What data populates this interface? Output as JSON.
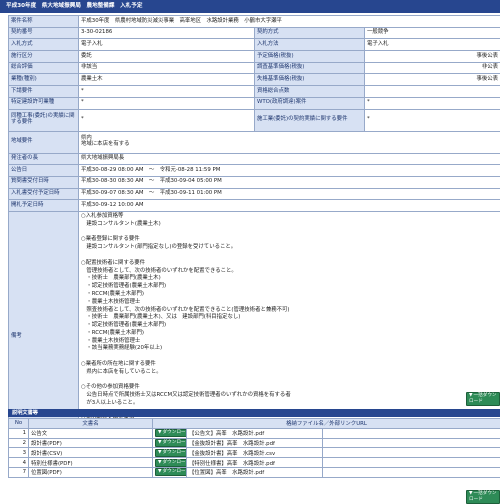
{
  "header": {
    "title": "平成30年度　県大地域振興局　農地整備課　入札予定"
  },
  "info_rows": [
    {
      "label1": "案件名称",
      "value1": "平成30年度　県農村地域防災減災事業　高峯地区　水路設計業務　小鶴市大字瀬平",
      "label2": "",
      "value2": "",
      "span": true
    },
    {
      "label1": "契約番号",
      "value1": "3-30-02186",
      "label2": "契約方式",
      "value2": "一般競争"
    },
    {
      "label1": "入札方式",
      "value1": "電子入札",
      "label2": "入札方法",
      "value2": "電子入札"
    },
    {
      "label1": "施行区分",
      "value1": "委託",
      "label2": "予定価格(税抜)",
      "value2": "事後公表"
    },
    {
      "label1": "総合評価",
      "value1": "非該当",
      "label2": "調査基準価格(税抜)",
      "value2": "非公表"
    },
    {
      "label1": "業種(種別)",
      "value1": "農業土木",
      "label2": "失格基準価格(税抜)",
      "value2": "事後公表"
    },
    {
      "label1": "下請要件",
      "value1": "*",
      "label2": "資格総合点数",
      "value2": ""
    },
    {
      "label1": "特定建設許可業種",
      "value1": "*",
      "label2": "WTO(政府調達)案件",
      "value2": "*"
    },
    {
      "label1": "同種工事(委託)の実績に関する要件",
      "value1": "*",
      "label2": "施工業(委託)の契約実績に関する要件",
      "value2": "*",
      "tall": true
    },
    {
      "label1": "地域要件",
      "value1": "県内\n地域に本店を有する",
      "label2": "",
      "value2": "",
      "span": true,
      "tall": true
    },
    {
      "label1": "発注者の長",
      "value1": "県大地域振興局長",
      "span": true
    },
    {
      "label1": "公告日",
      "value1": "平成30-08-29 08:00 AM　〜　令和元-08-28 11:59 PM",
      "span": true
    },
    {
      "label1": "質問書受付日時",
      "value1": "平成30-08-30 08:30 AM　〜　平成30-09-04 05:00 PM",
      "span": true
    },
    {
      "label1": "入札書受付予定日時",
      "value1": "平成30-09-07 08:30 AM　〜　平成30-09-11 01:00 PM",
      "span": true
    },
    {
      "label1": "開札予定日時",
      "value1": "平成30-09-12 10:00 AM",
      "span": true
    }
  ],
  "remarks": {
    "label": "備考",
    "text": "○入札参加資格等\n　建設コンサルタント(農業土木)\n\n○業者登録に関する要件\n　建設コンサルタント(部門指定なし)の登録を受けていること。\n\n○配置技術者に関する要件\n　管理技術者として、次の技術者のいずれかを配置できること。\n　・技術士　農業部門(農業土木)\n　・認定技術管理者(農業土木部門)\n　・RCCM(農業土木部門)\n　・農業土木技術管理士\n　照査技術者として、次の技術者のいずれかを配置できること(管理技術者と兼務不可)\n　・技術士　農業部門(農業土木)、又は　建設部門(科目指定なし)\n　・認定技術管理者(農業土木部門)\n　・RCCM(農業土木部門)\n　・農業土木技術管理士\n　・該当業務実務経験(20年以上)\n\n○業者所の所在地に関する要件\n　県内に本店を有していること。\n\n○その他の参加資格要件\n　公告日時点で所属技術士又はRCCM又は認定技術管理者のいずれかの資格を有する者\n　が3人以上いること。\n\n○その他指名配置事項\n　当該入札に参加した者への再委託はできません。\n\n○お願い\n　ファックスにより質問を出された方は、回答に正確を期するため、送信した旨の御一報を\n　御面倒でもお願いいたします。"
  },
  "revision": {
    "label": "修正内容履歴",
    "value": ""
  },
  "download_all_label": "一括ダウンロード",
  "docs_section": {
    "title": "説明文書等",
    "headers": {
      "no": "No",
      "doc": "文書名",
      "file": "格納ファイル名／外部リンクURL"
    },
    "download_label": "ダウンロード",
    "rows": [
      {
        "no": "1",
        "doc": "公告文",
        "file": "【公告文】高峯　水路設計.pdf"
      },
      {
        "no": "2",
        "doc": "設計書(PDF)",
        "file": "【金抜設計書】高峯　水路設計.pdf"
      },
      {
        "no": "3",
        "doc": "設計書(CSV)",
        "file": "【金抜設計書】高峯　水路設計.csv"
      },
      {
        "no": "4",
        "doc": "特別仕様書(PDF)",
        "file": "【特別仕様書】高峯　水路設計.pdf"
      },
      {
        "no": "7",
        "doc": "位置図(PDF)",
        "file": "【位置図】高峯　水路設計.pdf"
      }
    ]
  }
}
